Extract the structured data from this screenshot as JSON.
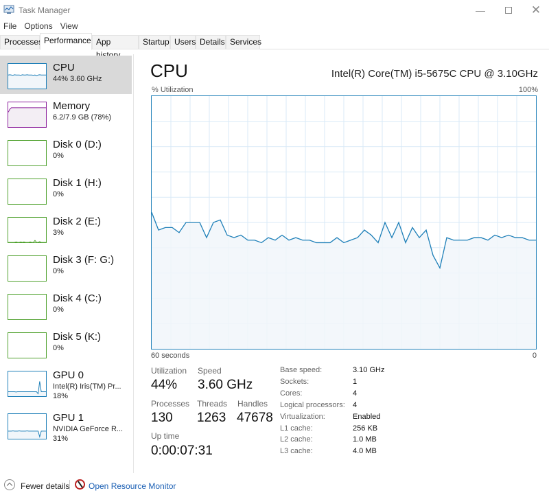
{
  "window": {
    "title": "Task Manager",
    "controls": [
      "minimize",
      "maximize",
      "close"
    ]
  },
  "menu": [
    "File",
    "Options",
    "View"
  ],
  "tabs": [
    {
      "label": "Processes",
      "active": false
    },
    {
      "label": "Performance",
      "active": true
    },
    {
      "label": "App history",
      "active": false
    },
    {
      "label": "Startup",
      "active": false
    },
    {
      "label": "Users",
      "active": false
    },
    {
      "label": "Details",
      "active": false
    },
    {
      "label": "Services",
      "active": false
    }
  ],
  "sidebar": [
    {
      "title": "CPU",
      "lines": [
        "44% 3.60 GHz"
      ],
      "color": "#1d7fb8",
      "fill": "#f1f6fa",
      "selected": true,
      "spark": [
        55,
        56,
        55,
        54,
        56,
        55,
        55,
        55,
        54,
        56,
        55,
        55,
        56,
        55,
        55,
        55,
        54,
        55,
        52,
        55,
        56,
        55,
        55,
        55,
        55
      ]
    },
    {
      "title": "Memory",
      "lines": [
        "6.2/7.9 GB (78%)"
      ],
      "color": "#8b1e9b",
      "fill": "#f3eef4",
      "selected": false,
      "spark": [
        60,
        72,
        78,
        78,
        78,
        78,
        78,
        78,
        78,
        78,
        78,
        78,
        78,
        78,
        78,
        78,
        78,
        78,
        78,
        78,
        78,
        78,
        78,
        78,
        78
      ]
    },
    {
      "title": "Disk 0 (D:)",
      "lines": [
        "0%"
      ],
      "color": "#4da02b",
      "fill": "#f4faf0",
      "selected": false,
      "spark": []
    },
    {
      "title": "Disk 1 (H:)",
      "lines": [
        "0%"
      ],
      "color": "#4da02b",
      "fill": "#f4faf0",
      "selected": false,
      "spark": []
    },
    {
      "title": "Disk 2 (E:)",
      "lines": [
        "3%"
      ],
      "color": "#4da02b",
      "fill": "#f4faf0",
      "selected": false,
      "spark": [
        0,
        0,
        0,
        0,
        0,
        2,
        0,
        0,
        2,
        0,
        2,
        0,
        0,
        0,
        2,
        0,
        0,
        8,
        0,
        0,
        3,
        0,
        0,
        0,
        0
      ]
    },
    {
      "title": "Disk 3 (F: G:)",
      "lines": [
        "0%"
      ],
      "color": "#4da02b",
      "fill": "#f4faf0",
      "selected": false,
      "spark": []
    },
    {
      "title": "Disk 4 (C:)",
      "lines": [
        "0%"
      ],
      "color": "#4da02b",
      "fill": "#f4faf0",
      "selected": false,
      "spark": []
    },
    {
      "title": "Disk 5 (K:)",
      "lines": [
        "0%"
      ],
      "color": "#4da02b",
      "fill": "#f4faf0",
      "selected": false,
      "spark": []
    },
    {
      "title": "GPU 0",
      "lines": [
        "Intel(R) Iris(TM) Pr...",
        "18%"
      ],
      "color": "#1d7fb8",
      "fill": "#f1f6fa",
      "selected": false,
      "spark": [
        18,
        18,
        18,
        18,
        18,
        17,
        18,
        18,
        18,
        18,
        18,
        18,
        18,
        18,
        18,
        18,
        18,
        18,
        18,
        10,
        60,
        18,
        18,
        18,
        18
      ]
    },
    {
      "title": "GPU 1",
      "lines": [
        "NVIDIA GeForce R...",
        "31%"
      ],
      "color": "#1d7fb8",
      "fill": "#f1f6fa",
      "selected": false,
      "spark": [
        31,
        31,
        31,
        32,
        31,
        31,
        31,
        32,
        31,
        31,
        31,
        31,
        32,
        31,
        31,
        31,
        31,
        31,
        31,
        31,
        8,
        31,
        31,
        31,
        31
      ]
    }
  ],
  "main": {
    "title": "CPU",
    "cpu_model": "Intel(R) Core(TM) i5-5675C CPU @ 3.10GHz",
    "graph_label": "% Utilization",
    "graph_max_label": "100%",
    "axis_left_label": "60 seconds",
    "axis_right_label": "0"
  },
  "chart_data": {
    "type": "area",
    "title": "% Utilization",
    "xlabel": "60 seconds",
    "ylabel": "% Utilization",
    "x_range": [
      60,
      0
    ],
    "ylim": [
      0,
      100
    ],
    "grid": true,
    "grid_cols": 20,
    "grid_rows": 10,
    "color": "#1d7fb8",
    "fill": "#f1f6fa",
    "values": [
      54,
      47,
      48,
      48,
      46,
      50,
      50,
      50,
      44,
      50,
      51,
      45,
      44,
      45,
      43,
      43,
      42,
      44,
      43,
      45,
      43,
      44,
      43,
      43,
      42,
      42,
      42,
      44,
      42,
      43,
      44,
      47,
      45,
      42,
      50,
      44,
      50,
      42,
      48,
      44,
      47,
      37,
      32,
      44,
      43,
      43,
      43,
      44,
      44,
      43,
      45,
      44,
      45,
      44,
      44,
      43,
      43
    ]
  },
  "stats": {
    "utilization": {
      "label": "Utilization",
      "value": "44%"
    },
    "speed": {
      "label": "Speed",
      "value": "3.60 GHz"
    },
    "processes": {
      "label": "Processes",
      "value": "130"
    },
    "threads": {
      "label": "Threads",
      "value": "1263"
    },
    "handles": {
      "label": "Handles",
      "value": "47678"
    },
    "uptime": {
      "label": "Up time",
      "value": "0:00:07:31"
    }
  },
  "details": [
    {
      "key": "Base speed:",
      "value": "3.10 GHz"
    },
    {
      "key": "Sockets:",
      "value": "1"
    },
    {
      "key": "Cores:",
      "value": "4"
    },
    {
      "key": "Logical processors:",
      "value": "4"
    },
    {
      "key": "Virtualization:",
      "value": "Enabled"
    },
    {
      "key": "L1 cache:",
      "value": "256 KB"
    },
    {
      "key": "L2 cache:",
      "value": "1.0 MB"
    },
    {
      "key": "L3 cache:",
      "value": "4.0 MB"
    }
  ],
  "footer": {
    "fewer_details": "Fewer details",
    "resource_monitor": "Open Resource Monitor"
  }
}
